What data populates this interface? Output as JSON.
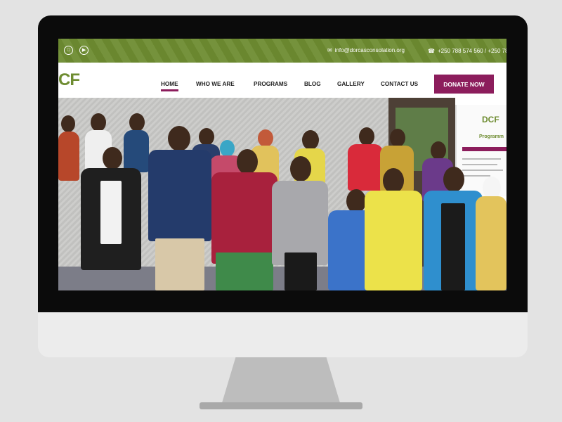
{
  "topbar": {
    "social_icons": [
      "instagram-icon",
      "youtube-icon"
    ],
    "email": "info@dorcasconsolation.org",
    "phone": "+250 788 574 560 / +250 78"
  },
  "navbar": {
    "logo_text": "CF",
    "items": [
      {
        "label": "HOME",
        "active": true
      },
      {
        "label": "WHO WE ARE",
        "active": false
      },
      {
        "label": "PROGRAMS",
        "active": false
      },
      {
        "label": "BLOG",
        "active": false
      },
      {
        "label": "GALLERY",
        "active": false
      },
      {
        "label": "CONTACT US",
        "active": false
      }
    ],
    "donate_label": "DONATE NOW"
  },
  "hero": {
    "banner_logo": "DCF",
    "banner_title": "Programm"
  },
  "colors": {
    "topbar": "#6e8c31",
    "accent": "#8c1d5c",
    "logo": "#6e8c31"
  }
}
